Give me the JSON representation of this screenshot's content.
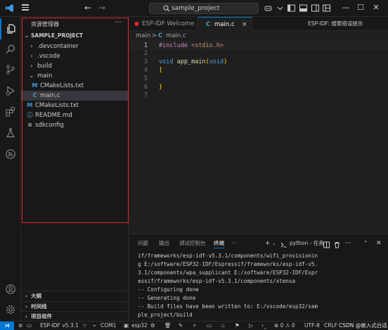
{
  "titlebar": {
    "search_text": "sample_project",
    "back_label": "←",
    "forward_label": "→"
  },
  "activity": {
    "items": [
      "explorer",
      "search",
      "source-control",
      "run-debug",
      "extensions",
      "testing",
      "esp-idf"
    ],
    "bottom": [
      "account",
      "manage"
    ]
  },
  "sidebar": {
    "header": "资源管理器",
    "more": "···",
    "project": "SAMPLE_PROJECT",
    "tree": [
      {
        "label": ".devcontainer",
        "type": "folder",
        "expanded": false
      },
      {
        "label": ".vscode",
        "type": "folder",
        "expanded": false
      },
      {
        "label": "build",
        "type": "folder",
        "expanded": false
      },
      {
        "label": "main",
        "type": "folder",
        "expanded": true
      },
      {
        "label": "CMakeLists.txt",
        "type": "cmake",
        "icon": "M"
      },
      {
        "label": "main.c",
        "type": "c",
        "icon": "C",
        "selected": true
      },
      {
        "label": "CMakeLists.txt",
        "type": "cmake",
        "icon": "M"
      },
      {
        "label": "README.md",
        "type": "info",
        "icon": "ⓘ"
      },
      {
        "label": "sdkconfig",
        "type": "settings",
        "icon": "≡"
      }
    ],
    "sections": [
      "大纲",
      "时间线",
      "项目组件"
    ]
  },
  "editor": {
    "tabs": [
      {
        "label": "ESP-IDF Welcome",
        "icon": "●",
        "active": false
      },
      {
        "label": "main.c",
        "icon": "C",
        "active": true,
        "close": "×"
      }
    ],
    "tabs_right": "ESP-IDF:  搜索错误提示",
    "breadcrumb": {
      "folder": "main",
      "sep": ">",
      "icon": "C",
      "file": "main.c"
    },
    "lines": [
      {
        "n": "1",
        "cur": true
      },
      {
        "n": "2"
      },
      {
        "n": "3"
      },
      {
        "n": "4"
      },
      {
        "n": "5"
      },
      {
        "n": "6"
      },
      {
        "n": "7"
      }
    ],
    "code": {
      "l1_inc": "#include",
      "l1_str": "<stdio.h>",
      "l3_type": "void",
      "l3_fn": "app_main",
      "l3_open": "(",
      "l3_type2": "void",
      "l3_close": ")",
      "l4": "{",
      "l6": "}"
    }
  },
  "panel": {
    "tabs": [
      "问题",
      "输出",
      "调试控制台",
      "终端",
      "···"
    ],
    "active_tab": "终端",
    "terminal_label": "python - 任务",
    "terminal_lines": [
      "if/frameworks/esp-idf-v5.3.1/components/wifi_provisionin",
      "g E:/software/ESP32-IDF/Espressif/frameworks/esp-idf-v5.",
      "3.1/components/wpa_supplicant E:/software/ESP32-IDF/Espr",
      "essif/frameworks/esp-idf-v5.3.1/components/xtensa",
      "-- Configuring done",
      "-- Generating done",
      "-- Build files have been written to: E:/vscode/esp32/sam",
      "ple_project/build"
    ]
  },
  "statusbar": {
    "remote": "⋊",
    "idf_version": "ESP-IDF v5.3.1",
    "port": "COM1",
    "target": "esp32",
    "problems": "⊗ 0 ⚠ 0",
    "encoding": "UTF-8",
    "eol": "CRLF",
    "watermark": "CSDN @嵌入式白话"
  }
}
